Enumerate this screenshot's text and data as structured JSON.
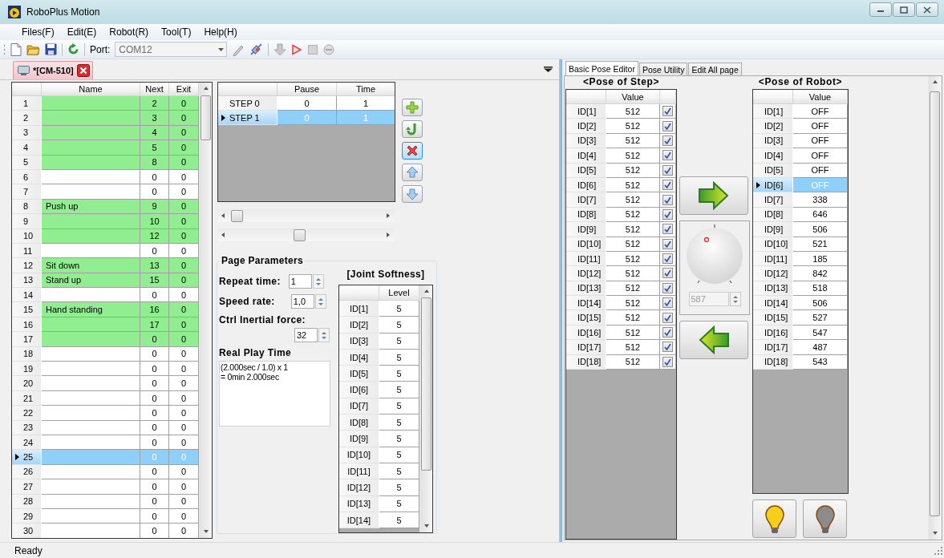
{
  "window": {
    "title": "RoboPlus Motion"
  },
  "menu": [
    "Files(F)",
    "Edit(E)",
    "Robot(R)",
    "Tool(T)",
    "Help(H)"
  ],
  "toolbar": {
    "port_label": "Port:",
    "port": {
      "value": "COM12",
      "disabled": true
    }
  },
  "document_tabs": [
    {
      "label": "*[CM-510]",
      "selected": true
    }
  ],
  "pages_table": {
    "columns": [
      "Name",
      "Next",
      "Exit"
    ],
    "rows": [
      {
        "number": "1",
        "next": "2",
        "exit": "0",
        "filled": true,
        "selected": false
      },
      {
        "number": "2",
        "next": "3",
        "exit": "0",
        "filled": true,
        "selected": false
      },
      {
        "number": "3",
        "next": "4",
        "exit": "0",
        "filled": true,
        "selected": false
      },
      {
        "number": "4",
        "next": "5",
        "exit": "0",
        "filled": true,
        "selected": false
      },
      {
        "number": "5",
        "next": "8",
        "exit": "0",
        "filled": true,
        "selected": false
      },
      {
        "number": "6",
        "next": "0",
        "exit": "0",
        "filled": false,
        "selected": false
      },
      {
        "number": "7",
        "next": "0",
        "exit": "0",
        "filled": false,
        "selected": false
      },
      {
        "number": "8",
        "name": "Push up",
        "next": "9",
        "exit": "0",
        "filled": true,
        "selected": false
      },
      {
        "number": "9",
        "next": "10",
        "exit": "0",
        "filled": true,
        "selected": false
      },
      {
        "number": "10",
        "next": "12",
        "exit": "0",
        "filled": true,
        "selected": false
      },
      {
        "number": "11",
        "next": "0",
        "exit": "0",
        "filled": false,
        "selected": false
      },
      {
        "number": "12",
        "name": "Sit down",
        "next": "13",
        "exit": "0",
        "filled": true,
        "selected": false
      },
      {
        "number": "13",
        "name": "Stand up",
        "next": "15",
        "exit": "0",
        "filled": true,
        "selected": false
      },
      {
        "number": "14",
        "next": "0",
        "exit": "0",
        "filled": false,
        "selected": false
      },
      {
        "number": "15",
        "name": "Hand standing",
        "next": "16",
        "exit": "0",
        "filled": true,
        "selected": false
      },
      {
        "number": "16",
        "next": "17",
        "exit": "0",
        "filled": true,
        "selected": false
      },
      {
        "number": "17",
        "next": "0",
        "exit": "0",
        "filled": true,
        "selected": false
      },
      {
        "number": "18",
        "next": "0",
        "exit": "0",
        "filled": false,
        "selected": false
      },
      {
        "number": "19",
        "next": "0",
        "exit": "0",
        "filled": false,
        "selected": false
      },
      {
        "number": "20",
        "next": "0",
        "exit": "0",
        "filled": false,
        "selected": false
      },
      {
        "number": "21",
        "next": "0",
        "exit": "0",
        "filled": false,
        "selected": false
      },
      {
        "number": "22",
        "next": "0",
        "exit": "0",
        "filled": false,
        "selected": false
      },
      {
        "number": "23",
        "next": "0",
        "exit": "0",
        "filled": false,
        "selected": false
      },
      {
        "number": "24",
        "next": "0",
        "exit": "0",
        "filled": false,
        "selected": false
      },
      {
        "number": "25",
        "next": "0",
        "exit": "0",
        "filled": false,
        "selected": true
      },
      {
        "number": "26",
        "next": "0",
        "exit": "0",
        "filled": false,
        "selected": false
      },
      {
        "number": "27",
        "next": "0",
        "exit": "0",
        "filled": false,
        "selected": false
      },
      {
        "number": "28",
        "next": "0",
        "exit": "0",
        "filled": false,
        "selected": false
      },
      {
        "number": "29",
        "next": "0",
        "exit": "0",
        "filled": false,
        "selected": false
      },
      {
        "number": "30",
        "next": "0",
        "exit": "0",
        "filled": false,
        "selected": false
      }
    ]
  },
  "steps_table": {
    "columns": [
      "Pause",
      "Time"
    ],
    "rows": [
      {
        "label": "STEP 0",
        "pause": "0",
        "time": "1",
        "selected": false
      },
      {
        "label": "STEP 1",
        "pause": "0",
        "time": "1",
        "selected": true
      }
    ]
  },
  "step_buttons": [
    {
      "kind": "add",
      "focused": false
    },
    {
      "kind": "insert",
      "focused": false
    },
    {
      "kind": "delete",
      "focused": true
    },
    {
      "kind": "up",
      "focused": false
    },
    {
      "kind": "down",
      "focused": false
    }
  ],
  "page_parameters": {
    "title": "Page Parameters",
    "repeat_time": {
      "label": "Repeat time:",
      "value": "1"
    },
    "speed_rate": {
      "label": "Speed rate:",
      "value": "1,0"
    },
    "ctrl_inertial_force": {
      "label": "Ctrl Inertial force:",
      "value": "32"
    },
    "real_play_time": {
      "label": "Real Play Time",
      "lines": [
        "(2.000sec / 1.0) x 1",
        "= 0min 2.000sec"
      ]
    }
  },
  "joint_softness": {
    "title": "[Joint Softness]",
    "columns": [
      "Level"
    ],
    "rows": [
      {
        "id": "ID[1]",
        "value": "5"
      },
      {
        "id": "ID[2]",
        "value": "5"
      },
      {
        "id": "ID[3]",
        "value": "5"
      },
      {
        "id": "ID[4]",
        "value": "5"
      },
      {
        "id": "ID[5]",
        "value": "5"
      },
      {
        "id": "ID[6]",
        "value": "5"
      },
      {
        "id": "ID[7]",
        "value": "5"
      },
      {
        "id": "ID[8]",
        "value": "5"
      },
      {
        "id": "ID[9]",
        "value": "5"
      },
      {
        "id": "ID[10]",
        "value": "5"
      },
      {
        "id": "ID[11]",
        "value": "5"
      },
      {
        "id": "ID[12]",
        "value": "5"
      },
      {
        "id": "ID[13]",
        "value": "5"
      },
      {
        "id": "ID[14]",
        "value": "5"
      }
    ]
  },
  "pose_tabs": [
    {
      "label": "Basic Pose Editor",
      "selected": true
    },
    {
      "label": "Pose Utility",
      "selected": false
    },
    {
      "label": "Edit All page",
      "selected": false
    }
  ],
  "pose_of_step": {
    "title": "<Pose of Step>",
    "columns": [
      "Value"
    ],
    "rows": [
      {
        "id": "ID[1]",
        "value": "512",
        "checked": true
      },
      {
        "id": "ID[2]",
        "value": "512",
        "checked": true
      },
      {
        "id": "ID[3]",
        "value": "512",
        "checked": true
      },
      {
        "id": "ID[4]",
        "value": "512",
        "checked": true
      },
      {
        "id": "ID[5]",
        "value": "512",
        "checked": true
      },
      {
        "id": "ID[6]",
        "value": "512",
        "checked": true
      },
      {
        "id": "ID[7]",
        "value": "512",
        "checked": true
      },
      {
        "id": "ID[8]",
        "value": "512",
        "checked": true
      },
      {
        "id": "ID[9]",
        "value": "512",
        "checked": true
      },
      {
        "id": "ID[10]",
        "value": "512",
        "checked": true
      },
      {
        "id": "ID[11]",
        "value": "512",
        "checked": true
      },
      {
        "id": "ID[12]",
        "value": "512",
        "checked": true
      },
      {
        "id": "ID[13]",
        "value": "512",
        "checked": true
      },
      {
        "id": "ID[14]",
        "value": "512",
        "checked": true
      },
      {
        "id": "ID[15]",
        "value": "512",
        "checked": true
      },
      {
        "id": "ID[16]",
        "value": "512",
        "checked": true
      },
      {
        "id": "ID[17]",
        "value": "512",
        "checked": true
      },
      {
        "id": "ID[18]",
        "value": "512",
        "checked": true
      }
    ]
  },
  "knob": {
    "value": "587",
    "disabled": true
  },
  "pose_of_robot": {
    "title": "<Pose of Robot>",
    "columns": [
      "Value"
    ],
    "rows": [
      {
        "id": "ID[1]",
        "value": "OFF",
        "selected": false
      },
      {
        "id": "ID[2]",
        "value": "OFF",
        "selected": false
      },
      {
        "id": "ID[3]",
        "value": "OFF",
        "selected": false
      },
      {
        "id": "ID[4]",
        "value": "OFF",
        "selected": false
      },
      {
        "id": "ID[5]",
        "value": "OFF",
        "selected": false
      },
      {
        "id": "ID[6]",
        "value": "OFF",
        "selected": true
      },
      {
        "id": "ID[7]",
        "value": "338",
        "selected": false
      },
      {
        "id": "ID[8]",
        "value": "646",
        "selected": false
      },
      {
        "id": "ID[9]",
        "value": "506",
        "selected": false
      },
      {
        "id": "ID[10]",
        "value": "521",
        "selected": false
      },
      {
        "id": "ID[11]",
        "value": "185",
        "selected": false
      },
      {
        "id": "ID[12]",
        "value": "842",
        "selected": false
      },
      {
        "id": "ID[13]",
        "value": "518",
        "selected": false
      },
      {
        "id": "ID[14]",
        "value": "506",
        "selected": false
      },
      {
        "id": "ID[15]",
        "value": "527",
        "selected": false
      },
      {
        "id": "ID[16]",
        "value": "547",
        "selected": false
      },
      {
        "id": "ID[17]",
        "value": "487",
        "selected": false
      },
      {
        "id": "ID[18]",
        "value": "543",
        "selected": false
      }
    ]
  },
  "status_bar": "Ready"
}
